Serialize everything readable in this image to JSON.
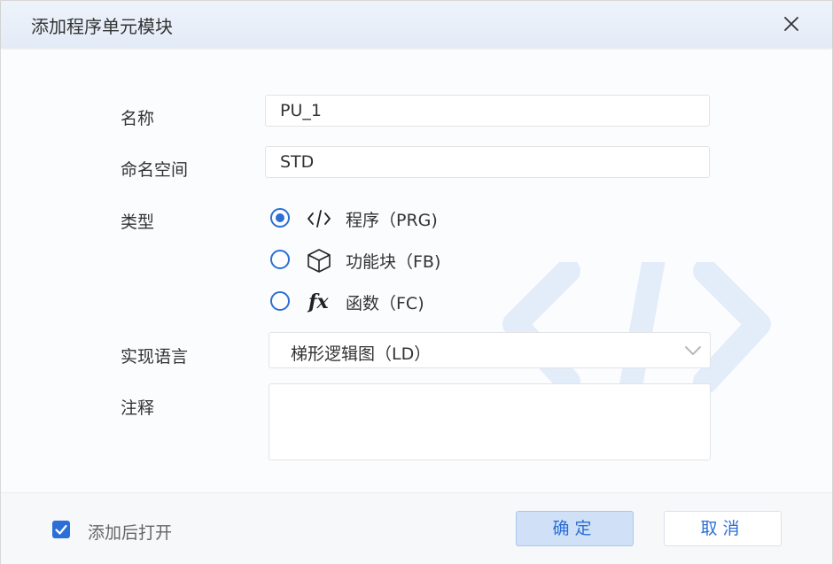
{
  "dialog": {
    "title": "添加程序单元模块",
    "fields": {
      "name_label": "名称",
      "name_value": "PU_1",
      "namespace_label": "命名空间",
      "namespace_value": "STD",
      "type_label": "类型",
      "language_label": "实现语言",
      "language_value": "梯形逻辑图（LD）",
      "comment_label": "注释",
      "comment_value": ""
    },
    "type_options": [
      {
        "label": "程序（PRG)",
        "icon": "code-brackets-icon",
        "selected": true
      },
      {
        "label": "功能块（FB)",
        "icon": "cube-icon",
        "selected": false
      },
      {
        "label": "函数（FC)",
        "icon": "function-fx-icon",
        "selected": false
      }
    ],
    "footer": {
      "open_after_add_label": "添加后打开",
      "open_after_add_checked": true,
      "ok_label": "确定",
      "cancel_label": "取消"
    }
  },
  "colors": {
    "accent": "#2b6fd6",
    "header_bg": "#e7edf8",
    "ok_bg": "#cfe0f7"
  }
}
